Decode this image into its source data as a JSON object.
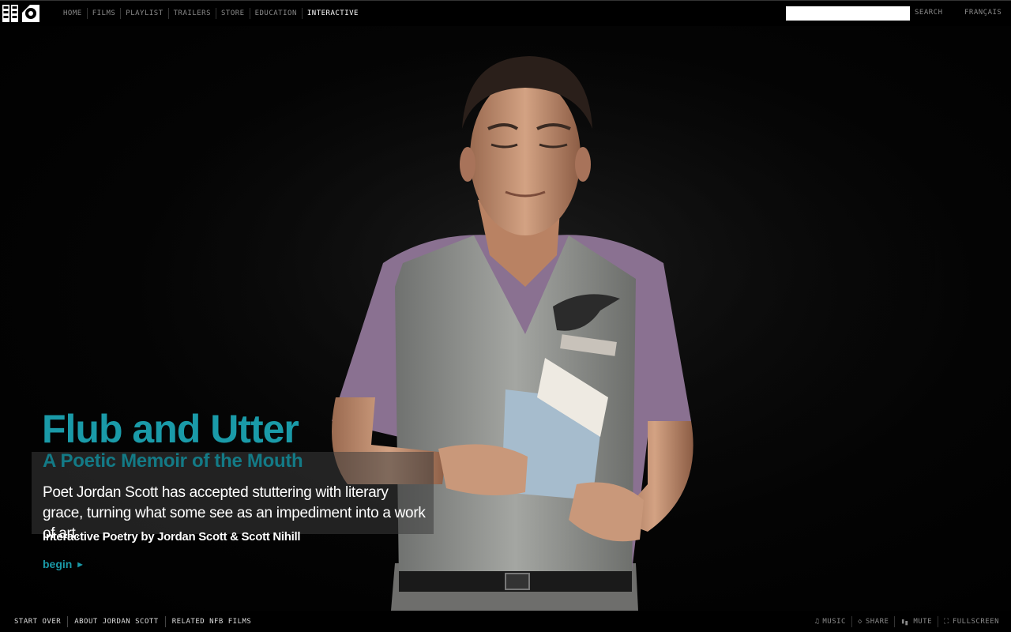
{
  "header": {
    "logo_text": "NFB ONF",
    "nav": [
      {
        "label": "HOME"
      },
      {
        "label": "FILMS"
      },
      {
        "label": "PLAYLIST"
      },
      {
        "label": "TRAILERS"
      },
      {
        "label": "STORE"
      },
      {
        "label": "EDUCATION"
      },
      {
        "label": "INTERACTIVE",
        "active": true
      }
    ],
    "search": {
      "value": "",
      "placeholder": "",
      "button_label": "SEARCH"
    },
    "language_link": "FRANÇAIS"
  },
  "hero": {
    "title": "Flub and Utter",
    "subtitle": "A Poetic Memoir of the Mouth",
    "description": "Poet Jordan Scott has accepted stuttering with literary grace, turning what some see as an impediment into a work of art.",
    "credit": "Interactive Poetry by Jordan Scott & Scott Nihill",
    "begin_label": "begin",
    "accent_color": "#1a9aa8"
  },
  "footer": {
    "nav": [
      {
        "label": "START OVER"
      },
      {
        "label": "ABOUT JORDAN SCOTT"
      },
      {
        "label": "RELATED NFB FILMS"
      }
    ],
    "controls": [
      {
        "label": "MUSIC",
        "icon": "music-note-icon"
      },
      {
        "label": "SHARE",
        "icon": "share-icon"
      },
      {
        "label": "MUTE",
        "icon": "volume-bars-icon"
      },
      {
        "label": "FULLSCREEN",
        "icon": "fullscreen-icon"
      }
    ]
  }
}
